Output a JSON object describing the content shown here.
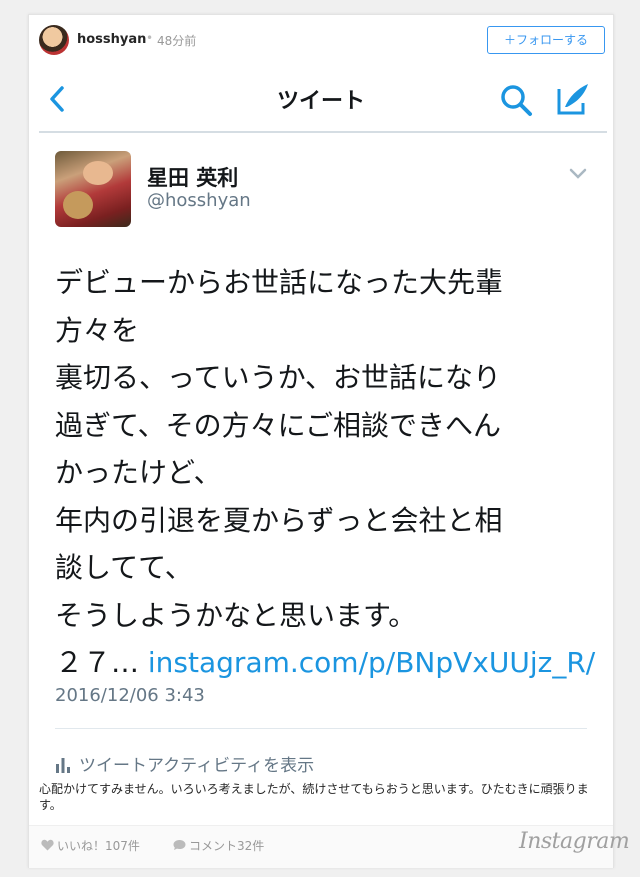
{
  "instagram": {
    "username": "hosshyan",
    "separator": "•",
    "time": "48分前",
    "follow_label": "＋フォローする",
    "logo": "Instagram",
    "caption": "心配かけてすみません。いろいろ考えましたが、続けさせてもらおうと思います。ひたむきに頑張ります。",
    "likes_label": "いいね！107件",
    "comments_label": "コメント32件"
  },
  "tweet": {
    "nav_title": "ツイート",
    "name": "星田 英利",
    "handle": "@hosshyan",
    "lines": [
      "デビューからお世話になった大先輩",
      "方々を",
      "裏切る、っていうか、お世話になり",
      "過ぎて、その方々にご相談できへん",
      "かったけど、",
      "年内の引退を夏からずっと会社と相",
      "談してて、",
      "そうしようかなと思います。"
    ],
    "last_line_prefix": "２７… ",
    "link": "instagram.com/p/BNpVxUUjz_R/",
    "date": "2016/12/06 3:43",
    "activity_label": "ツイートアクティビティを表示"
  },
  "colors": {
    "twitter_blue": "#1b95e0",
    "instagram_blue": "#3897f0",
    "muted": "#657786"
  },
  "icons": [
    "back-icon",
    "search-icon",
    "compose-icon",
    "chevron-down-icon",
    "activity-bar-icon",
    "heart-icon",
    "comment-icon"
  ]
}
